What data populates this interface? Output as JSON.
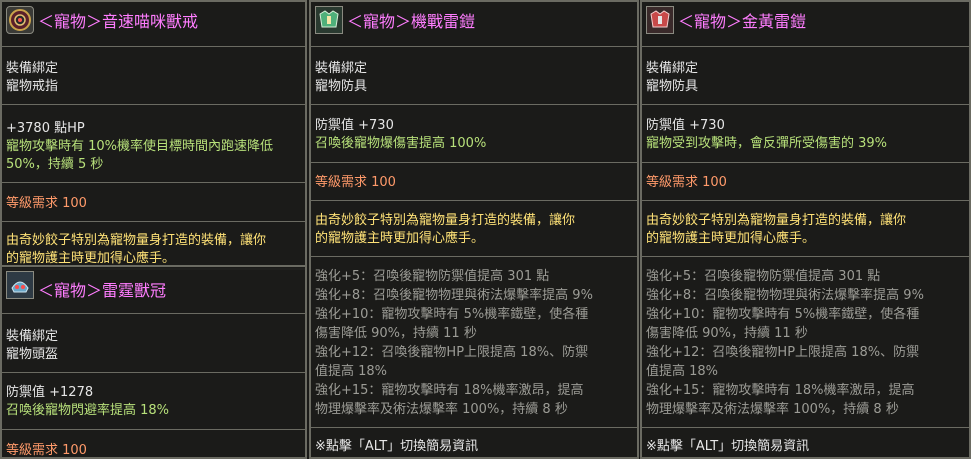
{
  "panel1": {
    "title": "＜寵物＞音速喵咪獸戒",
    "bind": "裝備綁定",
    "type": "寵物戒指",
    "stat": "+3780 點HP",
    "effect_line1": "寵物攻擊時有 10%機率使目標時間內跑速降低",
    "effect_line2": " 50%，持續 5 秒",
    "level": "等級需求 100",
    "desc_line1": "由奇妙餃子特別為寵物量身打造的裝備，讓你",
    "desc_line2": "的寵物護主時更加得心應手。"
  },
  "panel2": {
    "title": "＜寵物＞雷霆獸冠",
    "bind": "裝備綁定",
    "type": "寵物頭盔",
    "stat": "防禦值 +1278",
    "effect": "召喚後寵物閃避率提高 18%",
    "level": "等級需求 100"
  },
  "panel3": {
    "title": "＜寵物＞機戰雷鎧",
    "bind": "裝備綁定",
    "type": "寵物防具",
    "stat": "防禦值 +730",
    "effect": "召喚後寵物爆傷害提高 100%",
    "level": "等級需求 100",
    "desc_line1": "由奇妙餃子特別為寵物量身打造的裝備，讓你",
    "desc_line2": "的寵物護主時更加得心應手。",
    "enh": [
      "強化+5：召喚後寵物防禦值提高 301 點",
      "強化+8：召喚後寵物物理與術法爆擊率提高 9%",
      "強化+10：寵物攻擊時有 5%機率鐵壁，使各種",
      "傷害降低 90%，持續 11 秒",
      "強化+12：召喚後寵物HP上限提高 18%、防禦",
      "值提高 18%",
      "強化+15：寵物攻擊時有 18%機率激昂，提高",
      "物理爆擊率及術法爆擊率 100%，持續 8 秒"
    ],
    "footer": "※點擊「ALT」切換簡易資訊"
  },
  "panel4": {
    "title": "＜寵物＞金黃雷鎧",
    "bind": "裝備綁定",
    "type": "寵物防具",
    "stat": "防禦值 +730",
    "effect": "寵物受到攻擊時，會反彈所受傷害的 39%",
    "level": "等級需求 100",
    "desc_line1": "由奇妙餃子特別為寵物量身打造的裝備，讓你",
    "desc_line2": "的寵物護主時更加得心應手。",
    "enh": [
      "強化+5：召喚後寵物防禦值提高 301 點",
      "強化+8：召喚後寵物物理與術法爆擊率提高 9%",
      "強化+10：寵物攻擊時有 5%機率鐵壁，使各種",
      "傷害降低 90%，持續 11 秒",
      "強化+12：召喚後寵物HP上限提高 18%、防禦",
      "值提高 18%",
      "強化+15：寵物攻擊時有 18%機率激昂，提高",
      "物理爆擊率及術法爆擊率 100%，持續 8 秒"
    ],
    "footer": "※點擊「ALT」切換簡易資訊"
  },
  "colors": {
    "title": "#ff7dff",
    "white": "#e6e6e6",
    "green": "#b7e07a",
    "orange": "#ff9a6a",
    "yellow": "#ffe277",
    "gray": "#9c9c96",
    "border": "#6b6b62"
  },
  "icons": [
    "ring-icon",
    "helmet-icon",
    "armor-icon-green",
    "armor-icon-red"
  ]
}
